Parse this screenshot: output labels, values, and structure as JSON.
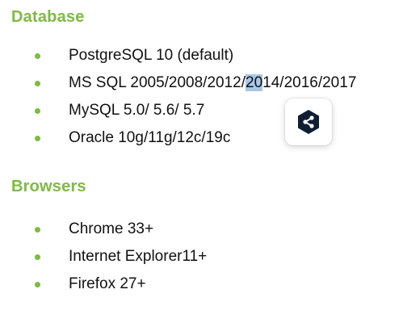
{
  "sections": {
    "database": {
      "title": "Database",
      "items": [
        {
          "text": "PostgreSQL 10 (default)"
        },
        {
          "text_before": "MS SQL 2005/2008/2012/",
          "text_selected": "20",
          "text_after": "14/2016/2017"
        },
        {
          "text": "MySQL 5.0/ 5.6/ 5.7"
        },
        {
          "text": "Oracle 10g/11g/12c/19c"
        }
      ]
    },
    "browsers": {
      "title": "Browsers",
      "items": [
        {
          "text": "Chrome 33+"
        },
        {
          "text": "Internet Explorer11+"
        },
        {
          "text": "Firefox 27+"
        }
      ]
    }
  },
  "floating_button": {
    "icon": "share-hexagon-icon"
  },
  "colors": {
    "accent_green": "#7dbb42",
    "text": "#111111",
    "selection": "#a8c7e6",
    "icon_dark": "#0f1e33"
  }
}
